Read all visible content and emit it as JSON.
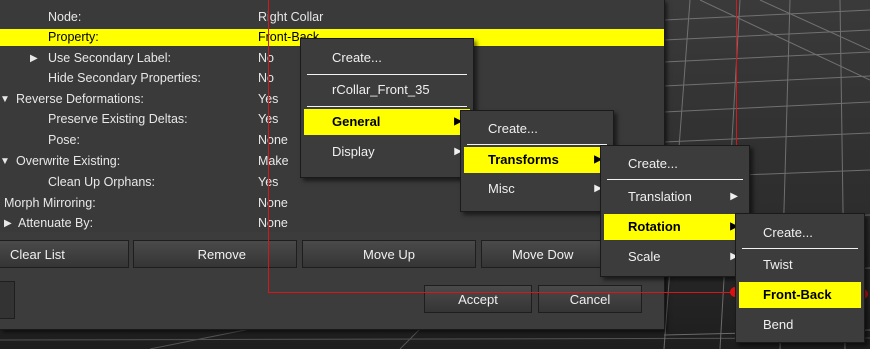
{
  "properties": {
    "rows": [
      {
        "label": "Node:",
        "value": "Right Collar",
        "expander": ""
      },
      {
        "label": "Property:",
        "value": "Front-Back",
        "expander": ""
      },
      {
        "label": "Use Secondary Label:",
        "value": "No",
        "expander": "▶"
      },
      {
        "label": "Hide Secondary Properties:",
        "value": "No",
        "expander": ""
      },
      {
        "label": "Reverse Deformations:",
        "value": "Yes",
        "expander": "▼"
      },
      {
        "label": "Preserve Existing Deltas:",
        "value": "Yes",
        "expander": ""
      },
      {
        "label": "Pose:",
        "value": "None",
        "expander": ""
      },
      {
        "label": "Overwrite Existing:",
        "value": "Make",
        "expander": "▼"
      },
      {
        "label": "Clean Up Orphans:",
        "value": "Yes",
        "expander": ""
      },
      {
        "label": "Morph Mirroring:",
        "value": "None",
        "expander": ""
      },
      {
        "label": "Attenuate By:",
        "value": "None",
        "expander": "▶"
      }
    ]
  },
  "buttons": {
    "clear_list": "Clear List",
    "remove": "Remove",
    "move_up": "Move Up",
    "move_down": "Move Dow",
    "accept": "Accept",
    "cancel": "Cancel"
  },
  "menus": {
    "main": {
      "create": "Create...",
      "rcollar": "rCollar_Front_35",
      "general": "General",
      "display": "Display"
    },
    "general": {
      "create": "Create...",
      "transforms": "Transforms",
      "misc": "Misc"
    },
    "transforms": {
      "create": "Create...",
      "translation": "Translation",
      "rotation": "Rotation",
      "scale": "Scale"
    },
    "rotation": {
      "create": "Create...",
      "twist": "Twist",
      "front_back": "Front-Back",
      "bend": "Bend"
    }
  },
  "icons": {
    "submenu_arrow": "submenu-arrow-icon",
    "expand": "expand-triangle-icon"
  },
  "colors": {
    "highlight": "#ffff00",
    "connector": "#d81818",
    "panel": "#3c3c3c"
  }
}
